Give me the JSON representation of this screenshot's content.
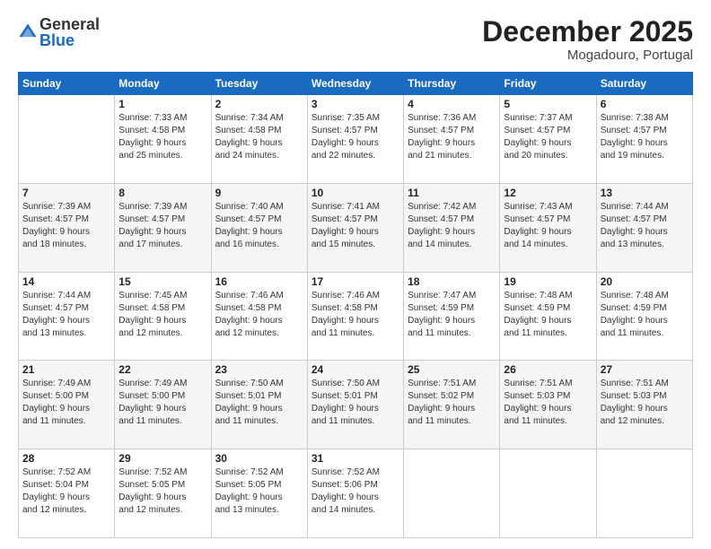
{
  "header": {
    "logo_general": "General",
    "logo_blue": "Blue",
    "month_title": "December 2025",
    "location": "Mogadouro, Portugal"
  },
  "days_of_week": [
    "Sunday",
    "Monday",
    "Tuesday",
    "Wednesday",
    "Thursday",
    "Friday",
    "Saturday"
  ],
  "weeks": [
    [
      {
        "day": "",
        "info": ""
      },
      {
        "day": "1",
        "info": "Sunrise: 7:33 AM\nSunset: 4:58 PM\nDaylight: 9 hours\nand 25 minutes."
      },
      {
        "day": "2",
        "info": "Sunrise: 7:34 AM\nSunset: 4:58 PM\nDaylight: 9 hours\nand 24 minutes."
      },
      {
        "day": "3",
        "info": "Sunrise: 7:35 AM\nSunset: 4:57 PM\nDaylight: 9 hours\nand 22 minutes."
      },
      {
        "day": "4",
        "info": "Sunrise: 7:36 AM\nSunset: 4:57 PM\nDaylight: 9 hours\nand 21 minutes."
      },
      {
        "day": "5",
        "info": "Sunrise: 7:37 AM\nSunset: 4:57 PM\nDaylight: 9 hours\nand 20 minutes."
      },
      {
        "day": "6",
        "info": "Sunrise: 7:38 AM\nSunset: 4:57 PM\nDaylight: 9 hours\nand 19 minutes."
      }
    ],
    [
      {
        "day": "7",
        "info": "Sunrise: 7:39 AM\nSunset: 4:57 PM\nDaylight: 9 hours\nand 18 minutes."
      },
      {
        "day": "8",
        "info": "Sunrise: 7:39 AM\nSunset: 4:57 PM\nDaylight: 9 hours\nand 17 minutes."
      },
      {
        "day": "9",
        "info": "Sunrise: 7:40 AM\nSunset: 4:57 PM\nDaylight: 9 hours\nand 16 minutes."
      },
      {
        "day": "10",
        "info": "Sunrise: 7:41 AM\nSunset: 4:57 PM\nDaylight: 9 hours\nand 15 minutes."
      },
      {
        "day": "11",
        "info": "Sunrise: 7:42 AM\nSunset: 4:57 PM\nDaylight: 9 hours\nand 14 minutes."
      },
      {
        "day": "12",
        "info": "Sunrise: 7:43 AM\nSunset: 4:57 PM\nDaylight: 9 hours\nand 14 minutes."
      },
      {
        "day": "13",
        "info": "Sunrise: 7:44 AM\nSunset: 4:57 PM\nDaylight: 9 hours\nand 13 minutes."
      }
    ],
    [
      {
        "day": "14",
        "info": "Sunrise: 7:44 AM\nSunset: 4:57 PM\nDaylight: 9 hours\nand 13 minutes."
      },
      {
        "day": "15",
        "info": "Sunrise: 7:45 AM\nSunset: 4:58 PM\nDaylight: 9 hours\nand 12 minutes."
      },
      {
        "day": "16",
        "info": "Sunrise: 7:46 AM\nSunset: 4:58 PM\nDaylight: 9 hours\nand 12 minutes."
      },
      {
        "day": "17",
        "info": "Sunrise: 7:46 AM\nSunset: 4:58 PM\nDaylight: 9 hours\nand 11 minutes."
      },
      {
        "day": "18",
        "info": "Sunrise: 7:47 AM\nSunset: 4:59 PM\nDaylight: 9 hours\nand 11 minutes."
      },
      {
        "day": "19",
        "info": "Sunrise: 7:48 AM\nSunset: 4:59 PM\nDaylight: 9 hours\nand 11 minutes."
      },
      {
        "day": "20",
        "info": "Sunrise: 7:48 AM\nSunset: 4:59 PM\nDaylight: 9 hours\nand 11 minutes."
      }
    ],
    [
      {
        "day": "21",
        "info": "Sunrise: 7:49 AM\nSunset: 5:00 PM\nDaylight: 9 hours\nand 11 minutes."
      },
      {
        "day": "22",
        "info": "Sunrise: 7:49 AM\nSunset: 5:00 PM\nDaylight: 9 hours\nand 11 minutes."
      },
      {
        "day": "23",
        "info": "Sunrise: 7:50 AM\nSunset: 5:01 PM\nDaylight: 9 hours\nand 11 minutes."
      },
      {
        "day": "24",
        "info": "Sunrise: 7:50 AM\nSunset: 5:01 PM\nDaylight: 9 hours\nand 11 minutes."
      },
      {
        "day": "25",
        "info": "Sunrise: 7:51 AM\nSunset: 5:02 PM\nDaylight: 9 hours\nand 11 minutes."
      },
      {
        "day": "26",
        "info": "Sunrise: 7:51 AM\nSunset: 5:03 PM\nDaylight: 9 hours\nand 11 minutes."
      },
      {
        "day": "27",
        "info": "Sunrise: 7:51 AM\nSunset: 5:03 PM\nDaylight: 9 hours\nand 12 minutes."
      }
    ],
    [
      {
        "day": "28",
        "info": "Sunrise: 7:52 AM\nSunset: 5:04 PM\nDaylight: 9 hours\nand 12 minutes."
      },
      {
        "day": "29",
        "info": "Sunrise: 7:52 AM\nSunset: 5:05 PM\nDaylight: 9 hours\nand 12 minutes."
      },
      {
        "day": "30",
        "info": "Sunrise: 7:52 AM\nSunset: 5:05 PM\nDaylight: 9 hours\nand 13 minutes."
      },
      {
        "day": "31",
        "info": "Sunrise: 7:52 AM\nSunset: 5:06 PM\nDaylight: 9 hours\nand 14 minutes."
      },
      {
        "day": "",
        "info": ""
      },
      {
        "day": "",
        "info": ""
      },
      {
        "day": "",
        "info": ""
      }
    ]
  ]
}
